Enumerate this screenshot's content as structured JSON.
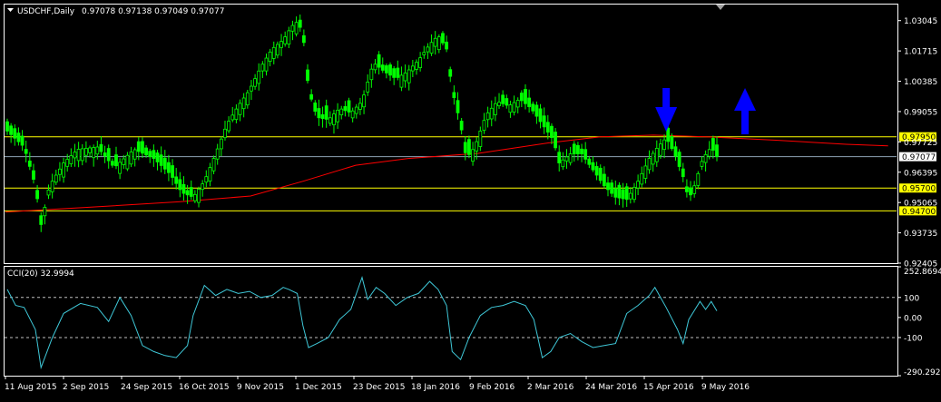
{
  "header": {
    "symbol": "USDCHF,Daily",
    "ohlc": "0.97078 0.97138 0.97049 0.97077"
  },
  "indicator": {
    "label": "CCI(20) 32.9994",
    "yticks": [
      "252.8694",
      "100",
      "0.00",
      "-100",
      "-290.2928"
    ]
  },
  "colors": {
    "background": "#000000",
    "frame": "#ffffff",
    "candle_up": "#00ff00",
    "ma_line": "#ff0000",
    "level_yellow": "#ffff00",
    "current_line": "#8ea2b5",
    "cci_line": "#3fc8d8",
    "arrow": "#0000ff"
  },
  "icons": {
    "dropdown": "triangle-down-icon",
    "down_arrow": "blue-down-arrow-icon",
    "up_arrow": "blue-up-arrow-icon"
  },
  "chart_data": [
    {
      "type": "candlestick",
      "title": "",
      "ylim": [
        0.92405,
        1.0375
      ],
      "yticks": [
        "1.03045",
        "1.01715",
        "1.00385",
        "0.99055",
        "0.97725",
        "0.96395",
        "0.95065",
        "0.93735",
        "0.92405"
      ],
      "x_dates": [
        "11 Aug 2015",
        "2 Sep 2015",
        "24 Sep 2015",
        "16 Oct 2015",
        "9 Nov 2015",
        "1 Dec 2015",
        "23 Dec 2015",
        "18 Jan 2016",
        "9 Feb 2016",
        "2 Mar 2016",
        "24 Mar 2016",
        "15 Apr 2016",
        "9 May 2016"
      ],
      "bars": 190,
      "close_path": [
        [
          0,
          0.982
        ],
        [
          6,
          0.975
        ],
        [
          10,
          0.958
        ],
        [
          12,
          0.941
        ],
        [
          15,
          0.958
        ],
        [
          20,
          0.968
        ],
        [
          25,
          0.974
        ],
        [
          32,
          0.975
        ],
        [
          38,
          0.966
        ],
        [
          45,
          0.974
        ],
        [
          52,
          0.97
        ],
        [
          58,
          0.963
        ],
        [
          62,
          0.955
        ],
        [
          66,
          0.953
        ],
        [
          70,
          0.96
        ],
        [
          74,
          0.972
        ],
        [
          78,
          0.985
        ],
        [
          82,
          0.993
        ],
        [
          86,
          1.0
        ],
        [
          90,
          1.01
        ],
        [
          94,
          1.018
        ],
        [
          98,
          1.022
        ],
        [
          101,
          1.028
        ],
        [
          103,
          1.03
        ],
        [
          105,
          1.025
        ],
        [
          107,
          1.0
        ],
        [
          110,
          0.988
        ],
        [
          114,
          0.987
        ],
        [
          118,
          0.992
        ],
        [
          122,
          0.99
        ],
        [
          126,
          0.995
        ],
        [
          130,
          1.012
        ],
        [
          134,
          1.008
        ],
        [
          138,
          1.005
        ],
        [
          142,
          1.008
        ],
        [
          146,
          1.013
        ],
        [
          150,
          1.02
        ],
        [
          153,
          1.024
        ],
        [
          156,
          1.018
        ],
        [
          158,
          1.0
        ],
        [
          161,
          0.985
        ],
        [
          163,
          0.97
        ],
        [
          166,
          0.975
        ],
        [
          170,
          0.989
        ],
        [
          174,
          0.995
        ],
        [
          178,
          0.993
        ],
        [
          182,
          0.996
        ],
        [
          186,
          0.992
        ],
        [
          190,
          0.985
        ],
        [
          194,
          0.978
        ],
        [
          196,
          0.968
        ],
        [
          200,
          0.972
        ],
        [
          204,
          0.972
        ],
        [
          208,
          0.965
        ],
        [
          212,
          0.958
        ],
        [
          216,
          0.953
        ],
        [
          220,
          0.952
        ],
        [
          224,
          0.96
        ],
        [
          228,
          0.97
        ],
        [
          231,
          0.975
        ],
        [
          234,
          0.979
        ],
        [
          237,
          0.972
        ],
        [
          240,
          0.962
        ],
        [
          242,
          0.952
        ],
        [
          244,
          0.958
        ],
        [
          247,
          0.97
        ],
        [
          250,
          0.975
        ],
        [
          252,
          0.97077
        ]
      ],
      "moving_average_path": [
        [
          0,
          0.9465
        ],
        [
          25,
          0.9487
        ],
        [
          50,
          0.951
        ],
        [
          70,
          0.9535
        ],
        [
          85,
          0.96
        ],
        [
          100,
          0.967
        ],
        [
          115,
          0.97
        ],
        [
          135,
          0.9722
        ],
        [
          155,
          0.9768
        ],
        [
          170,
          0.9795
        ],
        [
          185,
          0.9802
        ],
        [
          200,
          0.9795
        ],
        [
          220,
          0.978
        ],
        [
          240,
          0.9762
        ],
        [
          252,
          0.9755
        ]
      ],
      "levels": [
        {
          "value": 0.9795,
          "label": "0.97950",
          "color": "#ffff00"
        },
        {
          "value": 0.957,
          "label": "0.95700",
          "color": "#ffff00"
        },
        {
          "value": 0.947,
          "label": "0.94700",
          "color": "#ffff00"
        }
      ],
      "current_price": {
        "value": 0.97077,
        "label": "0.97077"
      },
      "annotations": [
        {
          "type": "arrow",
          "direction": "down",
          "bar": 234
        },
        {
          "type": "arrow",
          "direction": "up",
          "bar": 262
        }
      ]
    },
    {
      "type": "line",
      "title": "CCI(20) 32.9994",
      "ylim": [
        -290.2928,
        252.8694
      ],
      "levels": [
        100,
        -100
      ],
      "cci_path": [
        [
          0,
          140
        ],
        [
          3,
          60
        ],
        [
          6,
          50
        ],
        [
          10,
          -60
        ],
        [
          12,
          -250
        ],
        [
          16,
          -100
        ],
        [
          20,
          20
        ],
        [
          26,
          70
        ],
        [
          32,
          50
        ],
        [
          36,
          -20
        ],
        [
          40,
          100
        ],
        [
          44,
          10
        ],
        [
          48,
          -140
        ],
        [
          52,
          -170
        ],
        [
          56,
          -190
        ],
        [
          60,
          -200
        ],
        [
          64,
          -140
        ],
        [
          66,
          10
        ],
        [
          70,
          160
        ],
        [
          74,
          110
        ],
        [
          78,
          140
        ],
        [
          82,
          120
        ],
        [
          86,
          130
        ],
        [
          90,
          100
        ],
        [
          94,
          110
        ],
        [
          98,
          150
        ],
        [
          100,
          140
        ],
        [
          103,
          120
        ],
        [
          105,
          -40
        ],
        [
          107,
          -150
        ],
        [
          110,
          -130
        ],
        [
          114,
          -100
        ],
        [
          118,
          -10
        ],
        [
          122,
          40
        ],
        [
          126,
          200
        ],
        [
          128,
          90
        ],
        [
          131,
          150
        ],
        [
          134,
          120
        ],
        [
          138,
          60
        ],
        [
          142,
          100
        ],
        [
          146,
          120
        ],
        [
          150,
          180
        ],
        [
          153,
          140
        ],
        [
          156,
          60
        ],
        [
          158,
          -170
        ],
        [
          161,
          -210
        ],
        [
          164,
          -100
        ],
        [
          168,
          10
        ],
        [
          172,
          50
        ],
        [
          176,
          60
        ],
        [
          180,
          80
        ],
        [
          184,
          60
        ],
        [
          187,
          -10
        ],
        [
          190,
          -200
        ],
        [
          193,
          -170
        ],
        [
          196,
          -100
        ],
        [
          200,
          -80
        ],
        [
          204,
          -120
        ],
        [
          208,
          -150
        ],
        [
          212,
          -140
        ],
        [
          216,
          -130
        ],
        [
          220,
          20
        ],
        [
          224,
          60
        ],
        [
          228,
          110
        ],
        [
          230,
          150
        ],
        [
          234,
          50
        ],
        [
          238,
          -60
        ],
        [
          240,
          -130
        ],
        [
          242,
          -10
        ],
        [
          246,
          80
        ],
        [
          248,
          40
        ],
        [
          250,
          80
        ],
        [
          252,
          33
        ]
      ]
    }
  ]
}
